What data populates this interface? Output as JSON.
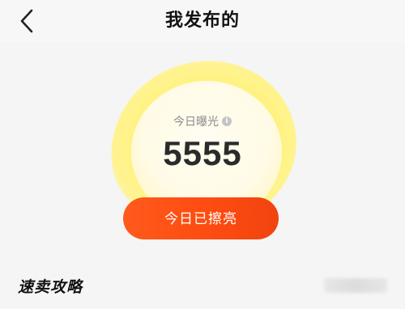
{
  "header": {
    "title": "我发布的",
    "back_icon": "chevron-left-icon"
  },
  "stats": {
    "exposure_label": "今日曝光",
    "info_icon": "info-icon",
    "exposure_value": "5555"
  },
  "action": {
    "shine_label": "今日已擦亮"
  },
  "tips": {
    "title": "速卖攻略"
  },
  "colors": {
    "accent": "#ff4d12",
    "glow": "#fff27a",
    "background": "#f5f5f5"
  }
}
